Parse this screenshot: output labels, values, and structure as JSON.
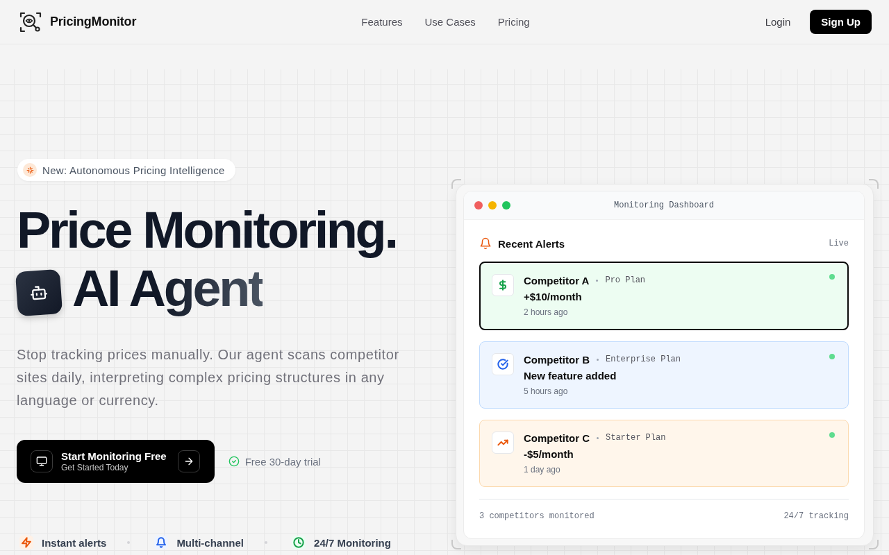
{
  "header": {
    "brand": "PricingMonitor",
    "nav": [
      {
        "label": "Features"
      },
      {
        "label": "Use Cases"
      },
      {
        "label": "Pricing"
      }
    ],
    "login": "Login",
    "signup": "Sign Up"
  },
  "hero": {
    "badge": "New: Autonomous Pricing Intelligence",
    "title_line_1": "Price Monitoring.",
    "title_line_2": "AI Agent",
    "description": "Stop tracking prices manually. Our agent scans competitor sites daily, interpreting complex pricing structures in any language or currency.",
    "cta": {
      "title": "Start Monitoring Free",
      "subtitle": "Get Started Today"
    },
    "trial_note": "Free 30-day trial",
    "features": [
      {
        "label": "Instant alerts",
        "kind": "bolt",
        "color": "#ea580c"
      },
      {
        "label": "Multi-channel",
        "kind": "bell",
        "color": "#2563eb"
      },
      {
        "label": "24/7 Monitoring",
        "kind": "clock",
        "color": "#16a34a"
      }
    ]
  },
  "dashboard": {
    "title": "Monitoring Dashboard",
    "controls": [
      {
        "color": "#f05f5f"
      },
      {
        "color": "#f5b400"
      },
      {
        "color": "#22c55e"
      }
    ],
    "section_title": "Recent Alerts",
    "status": "Live",
    "alerts": [
      {
        "competitor": "Competitor A",
        "plan": "Pro Plan",
        "change": "+$10/month",
        "time": "2 hours ago",
        "kind": "increase",
        "color": "#16a34a",
        "selected": true
      },
      {
        "competitor": "Competitor B",
        "plan": "Enterprise Plan",
        "change": "New feature added",
        "time": "5 hours ago",
        "kind": "feature",
        "color": "#2563eb",
        "selected": false
      },
      {
        "competitor": "Competitor C",
        "plan": "Starter Plan",
        "change": "-$5/month",
        "time": "1 day ago",
        "kind": "decrease",
        "color": "#ea580c",
        "selected": false
      }
    ],
    "footer_left": "3 competitors monitored",
    "footer_right": "24/7 tracking"
  }
}
